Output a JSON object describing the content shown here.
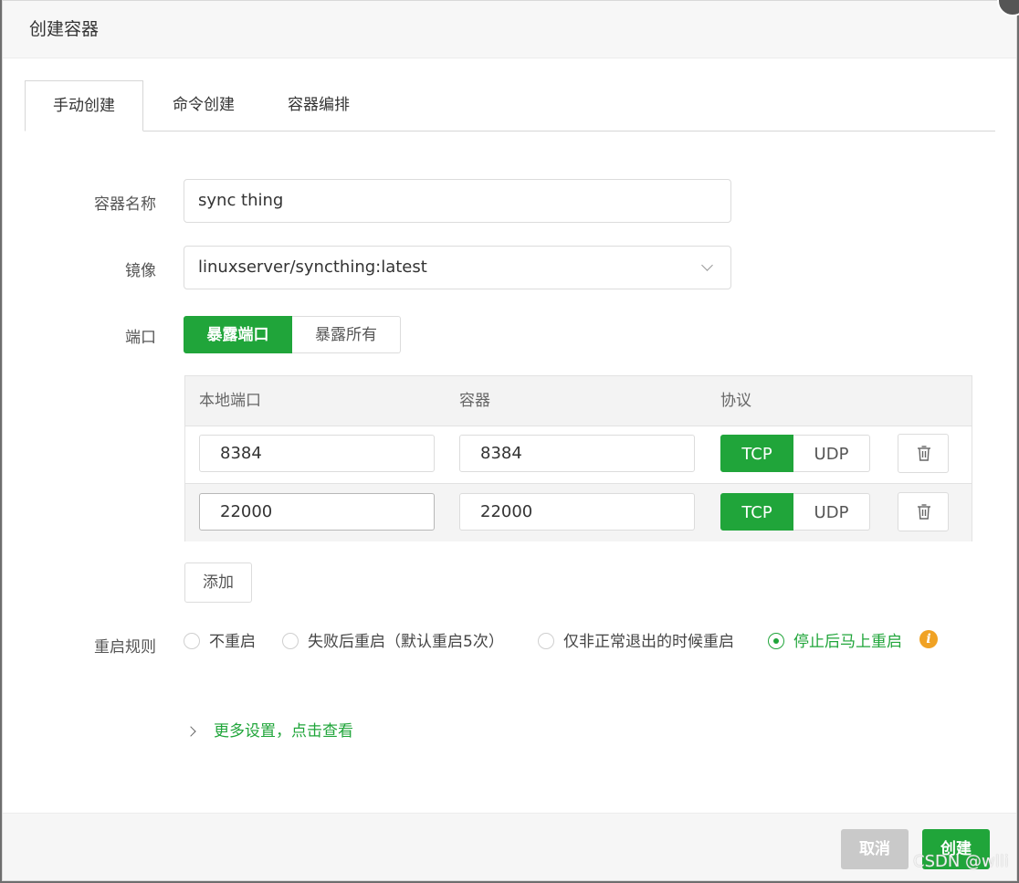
{
  "dialog": {
    "title": "创建容器"
  },
  "tabs": [
    {
      "label": "手动创建",
      "active": true
    },
    {
      "label": "命令创建",
      "active": false
    },
    {
      "label": "容器编排",
      "active": false
    }
  ],
  "form": {
    "name_label": "容器名称",
    "name_value": "sync thing",
    "image_label": "镜像",
    "image_value": "linuxserver/syncthing:latest",
    "port_label": "端口",
    "port_modes": [
      {
        "label": "暴露端口",
        "selected": true
      },
      {
        "label": "暴露所有",
        "selected": false
      }
    ],
    "port_table": {
      "headers": [
        "本地端口",
        "容器",
        "协议"
      ],
      "rows": [
        {
          "local": "8384",
          "container": "8384",
          "protocols": [
            "TCP",
            "UDP"
          ],
          "selected": "TCP"
        },
        {
          "local": "22000",
          "container": "22000",
          "protocols": [
            "TCP",
            "UDP"
          ],
          "selected": "TCP"
        }
      ]
    },
    "add_label": "添加",
    "restart_label": "重启规则",
    "restart_options": [
      {
        "label": "不重启",
        "selected": false
      },
      {
        "label": "失败后重启（默认重启5次）",
        "selected": false
      },
      {
        "label": "仅非正常退出的时候重启",
        "selected": false
      },
      {
        "label": "停止后马上重启",
        "selected": true
      }
    ],
    "info_icon": "i",
    "more_settings": "更多设置，点击查看"
  },
  "footer": {
    "cancel_label": "取消",
    "create_label": "创建"
  },
  "watermark": "CSDN @wlli",
  "colors": {
    "accent": "#20a53a",
    "info": "#f0a224",
    "disabled": "#c9c9c9"
  }
}
